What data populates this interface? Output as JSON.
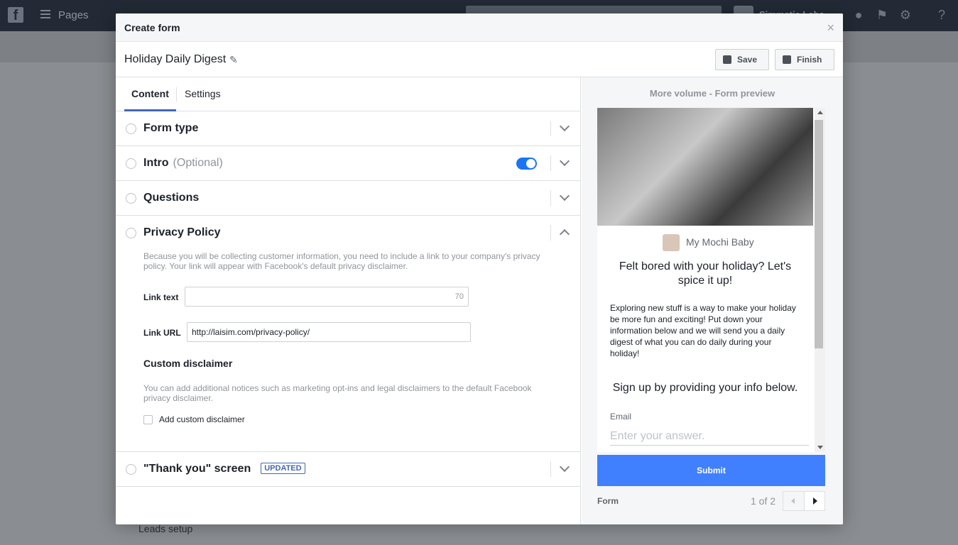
{
  "topbar": {
    "logo": "f",
    "pages_label": "Pages",
    "user_name": "Simmatia Labs",
    "icons": [
      "bell-icon",
      "flag-icon",
      "gear-icon",
      "help-icon"
    ]
  },
  "background": {
    "leads_setup": "Leads setup"
  },
  "modal": {
    "title": "Create form",
    "close": "×",
    "form_name": "Holiday Daily Digest",
    "save_label": "Save",
    "finish_label": "Finish",
    "tabs": [
      {
        "label": "Content",
        "active": true
      },
      {
        "label": "Settings",
        "active": false
      }
    ],
    "sections": {
      "form_type": {
        "title": "Form type"
      },
      "intro": {
        "title": "Intro",
        "optional": "(Optional)",
        "enabled": true
      },
      "questions": {
        "title": "Questions"
      },
      "privacy": {
        "title": "Privacy Policy",
        "help": "Because you will be collecting customer information, you need to include a link to your company's privacy policy. Your link will appear with Facebook's default privacy disclaimer.",
        "link_text_label": "Link text",
        "link_text_value": "",
        "link_text_counter": "70",
        "link_url_label": "Link URL",
        "link_url_value": "http://laisim.com/privacy-policy/",
        "custom_disclaimer_title": "Custom disclaimer",
        "custom_disclaimer_help": "You can add additional notices such as marketing opt-ins and legal disclaimers to the default Facebook privacy disclaimer.",
        "add_custom_label": "Add custom disclaimer",
        "add_custom_checked": false
      },
      "thank_you": {
        "title": "\"Thank you\" screen",
        "badge": "UPDATED"
      }
    }
  },
  "preview": {
    "title": "More volume - Form preview",
    "page_name": "My Mochi Baby",
    "headline": "Felt bored with your holiday? Let's spice it up!",
    "description": "Exploring new stuff is a way to make your holiday be more fun and exciting! Put down your information below and we will send you a daily digest of what you can do daily during your holiday!",
    "signup": "Sign up by providing your info below.",
    "email_label": "Email",
    "email_placeholder": "Enter your answer.",
    "submit": "Submit",
    "footer_label": "Form",
    "page_indicator": "1 of 2"
  },
  "colors": {
    "accent": "#4267b2",
    "toggle": "#1876f2",
    "submit": "#4080ff"
  }
}
